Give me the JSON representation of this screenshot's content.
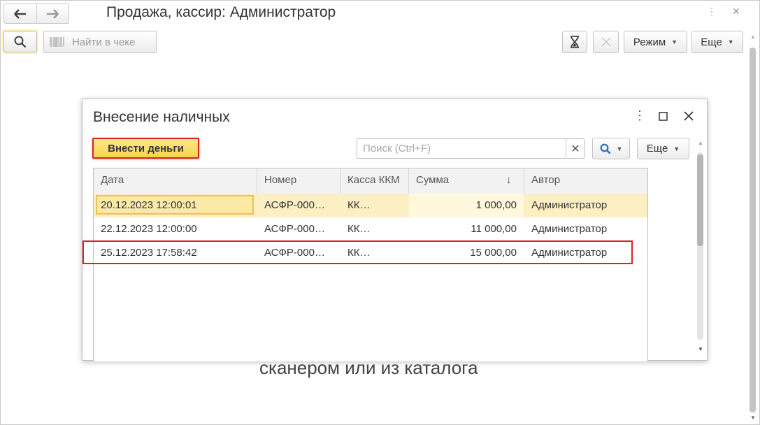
{
  "window": {
    "title": "Продажа, кассир: Администратор"
  },
  "toolbar": {
    "find_label": "Найти в чеке",
    "mode_label": "Режим",
    "more_label": "Еще"
  },
  "background": {
    "hint_text": "сканером или из каталога"
  },
  "dialog": {
    "title": "Внесение наличных",
    "primary_button": "Внести деньги",
    "search_placeholder": "Поиск (Ctrl+F)",
    "more_label": "Еще",
    "table": {
      "columns": [
        "Дата",
        "Номер",
        "Касса ККМ",
        "Сумма",
        "Автор"
      ],
      "sort_indicator": "↓",
      "rows": [
        {
          "date": "20.12.2023 12:00:01",
          "number": "АСФР-000…",
          "kkm": "КК…",
          "amount": "1 000,00",
          "author": "Администратор"
        },
        {
          "date": "22.12.2023 12:00:00",
          "number": "АСФР-000…",
          "kkm": "КК…",
          "amount": "11 000,00",
          "author": "Администратор"
        },
        {
          "date": "25.12.2023 17:58:42",
          "number": "АСФР-000…",
          "kkm": "КК…",
          "amount": "15 000,00",
          "author": "Администратор"
        }
      ]
    }
  },
  "icons": {
    "back": "arrow-left-icon",
    "forward": "arrow-right-icon",
    "search": "magnifier-icon",
    "barcode": "barcode-icon",
    "hourglass": "hourglass-icon",
    "close": "close-icon",
    "kebab": "kebab-icon",
    "maximize": "maximize-icon"
  },
  "colors": {
    "primary_button": "#f7d44a",
    "selected_row": "#fbefc3",
    "highlight_frame": "#e02020",
    "search_icon": "#1f6fc5"
  }
}
